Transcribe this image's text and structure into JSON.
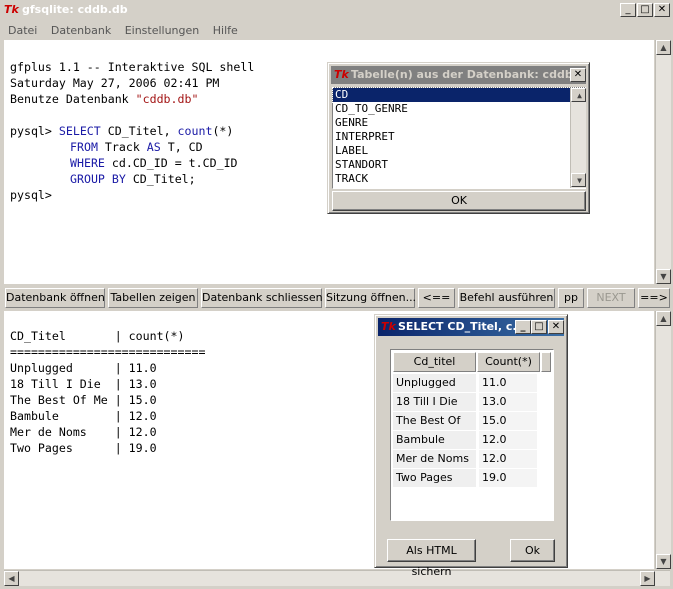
{
  "window": {
    "title": "gfsqlite: cddb.db",
    "logo": "Tk"
  },
  "menu": [
    "Datei",
    "Datenbank",
    "Einstellungen",
    "Hilfe"
  ],
  "shell": {
    "line1": "gfplus 1.1 -- Interaktive SQL shell",
    "line2": "Saturday May 27, 2006 02:41 PM",
    "line3_prefix": "Benutze Datenbank ",
    "line3_db": "\"cddb.db\"",
    "prompt": "pysql>",
    "select_kw": "SELECT",
    "select_rest": " CD_Titel, ",
    "count_kw": "count",
    "count_rest": "(*)",
    "from_kw": "FROM",
    "from_rest": " Track ",
    "as_kw": "AS",
    "as_rest": " T, CD",
    "where_kw": "WHERE",
    "where_rest": " cd.CD_ID = t.CD_ID",
    "group_kw": "GROUP BY",
    "group_rest": " CD_Titel;",
    "prompt2": "pysql>"
  },
  "toolbar": {
    "open_db": "Datenbank öffnen",
    "show_tables": "Tabellen zeigen",
    "close_db": "Datenbank schliessen",
    "open_session": "Sitzung öffnen...",
    "prev": "<==",
    "execute": "Befehl ausführen",
    "pp": "pp",
    "next": "NEXT",
    "fwd": "==>"
  },
  "output": {
    "header": "CD_Titel       | count(*)",
    "separator": "============================",
    "rows": [
      "Unplugged      | 11.0",
      "18 Till I Die  | 13.0",
      "The Best Of Me | 15.0",
      "Bambule        | 12.0",
      "Mer de Noms    | 12.0",
      "Two Pages      | 19.0"
    ]
  },
  "tables_dialog": {
    "title": "Tabelle(n) aus der Datenbank: cddb...",
    "items": [
      "CD",
      "CD_TO_GENRE",
      "GENRE",
      "INTERPRET",
      "LABEL",
      "STANDORT",
      "TRACK"
    ],
    "selected": "CD",
    "ok": "OK"
  },
  "result_dialog": {
    "title": "SELECT CD_Titel, c...",
    "columns": [
      "Cd_titel",
      "Count(*)"
    ],
    "rows": [
      [
        "Unplugged",
        "11.0"
      ],
      [
        "18 Till I Die",
        "13.0"
      ],
      [
        "The Best Of Me",
        "15.0"
      ],
      [
        "Bambule",
        "12.0"
      ],
      [
        "Mer de Noms",
        "12.0"
      ],
      [
        "Two Pages",
        "19.0"
      ]
    ],
    "save_html": "Als HTML sichern",
    "ok": "Ok"
  }
}
